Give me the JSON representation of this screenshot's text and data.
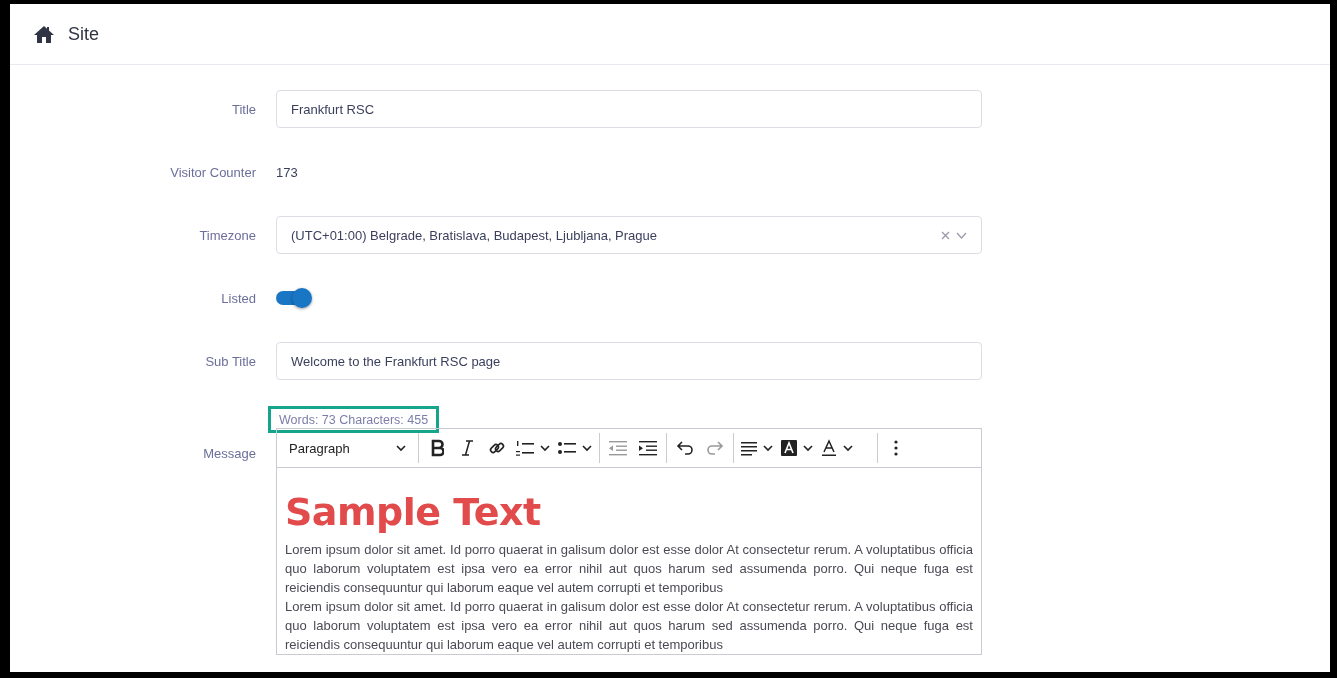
{
  "header": {
    "title": "Site"
  },
  "fields": [
    {
      "kind": "text",
      "label": "Title",
      "value": "Frankfurt RSC"
    },
    {
      "kind": "static",
      "label": "Visitor Counter",
      "value": "173"
    },
    {
      "kind": "select",
      "label": "Timezone",
      "value": "(UTC+01:00) Belgrade, Bratislava, Budapest, Ljubljana, Prague",
      "clearable": true
    },
    {
      "kind": "toggle",
      "label": "Listed",
      "on": true
    },
    {
      "kind": "text",
      "label": "Sub Title",
      "value": "Welcome to the Frankfurt RSC page"
    }
  ],
  "editor": {
    "label": "Message",
    "word_count": "Words: 73 Characters: 455",
    "highlighted": true,
    "toolbar": [
      {
        "kind": "format",
        "value": "Paragraph"
      },
      {
        "kind": "sep"
      },
      {
        "kind": "bold",
        "disabled": false
      },
      {
        "kind": "italic",
        "disabled": false
      },
      {
        "kind": "link",
        "disabled": false
      },
      {
        "kind": "numbered",
        "disabled": false,
        "dropdown": true
      },
      {
        "kind": "bulleted",
        "disabled": false,
        "dropdown": true
      },
      {
        "kind": "sep"
      },
      {
        "kind": "outdent",
        "disabled": true
      },
      {
        "kind": "indent",
        "disabled": false
      },
      {
        "kind": "sep"
      },
      {
        "kind": "undo",
        "disabled": false
      },
      {
        "kind": "redo",
        "disabled": true
      },
      {
        "kind": "sep"
      },
      {
        "kind": "align",
        "disabled": false,
        "dropdown": true
      },
      {
        "kind": "highlight",
        "disabled": false,
        "dropdown": true
      },
      {
        "kind": "fontcolor",
        "disabled": false,
        "dropdown": true
      },
      {
        "kind": "sep"
      },
      {
        "kind": "more",
        "disabled": false
      }
    ],
    "heading": "Sample Text",
    "paragraphs": [
      "Lorem ipsum dolor sit amet. Id porro quaerat in galisum dolor est esse dolor At consectetur rerum. A voluptatibus officia quo laborum voluptatem est ipsa vero ea error nihil aut quos harum sed assumenda porro. Qui neque fuga est reiciendis consequuntur qui laborum eaque vel autem corrupti et temporibus",
      "Lorem ipsum dolor sit amet. Id porro quaerat in galisum dolor est esse dolor At consectetur rerum. A voluptatibus officia quo laborum voluptatem est ipsa vero ea error nihil aut quos harum sed assumenda porro. Qui neque fuga est reiciendis consequuntur qui laborum eaque vel autem corrupti et temporibus"
    ]
  }
}
